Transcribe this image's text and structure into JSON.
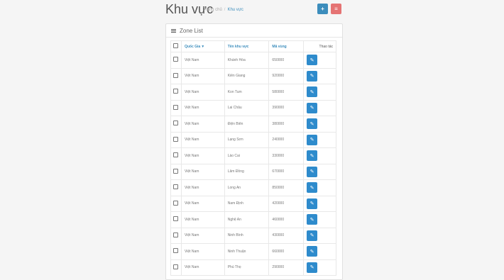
{
  "header": {
    "title": "Khu vực",
    "breadcrumb_home": "Trang chủ",
    "breadcrumb_sep": "/",
    "breadcrumb_current": "Khu vực",
    "add_icon": "plus-icon",
    "delete_icon": "list-delete-icon"
  },
  "panel": {
    "title": "Zone List"
  },
  "table": {
    "columns": {
      "country": "Quốc Gia",
      "country_sort": "▼",
      "zone_name": "Tên khu vực",
      "zone_code": "Mã vùng",
      "actions": "Thao tác"
    },
    "rows": [
      {
        "country": "Việt Nam",
        "name": "Khánh Hòa",
        "code": "650000"
      },
      {
        "country": "Việt Nam",
        "name": "Kiên Giang",
        "code": "920000"
      },
      {
        "country": "Việt Nam",
        "name": "Kon Tum",
        "code": "580000"
      },
      {
        "country": "Việt Nam",
        "name": "Lai Châu",
        "code": "390000"
      },
      {
        "country": "Việt Nam",
        "name": "Điện Biên",
        "code": "380000"
      },
      {
        "country": "Việt Nam",
        "name": "Lạng Sơn",
        "code": "240000"
      },
      {
        "country": "Việt Nam",
        "name": "Lào Cai",
        "code": "330000"
      },
      {
        "country": "Việt Nam",
        "name": "Lâm Đồng",
        "code": "670000"
      },
      {
        "country": "Việt Nam",
        "name": "Long An",
        "code": "850000"
      },
      {
        "country": "Việt Nam",
        "name": "Nam Định",
        "code": "420000"
      },
      {
        "country": "Việt Nam",
        "name": "Nghệ An",
        "code": "460000"
      },
      {
        "country": "Việt Nam",
        "name": "Ninh Bình",
        "code": "430000"
      },
      {
        "country": "Việt Nam",
        "name": "Ninh Thuận",
        "code": "660000"
      },
      {
        "country": "Việt Nam",
        "name": "Phú Thọ",
        "code": "290000"
      }
    ]
  },
  "colors": {
    "accent": "#3c8dbc",
    "danger": "#e57373",
    "edit_button": "#2e8bcc"
  }
}
